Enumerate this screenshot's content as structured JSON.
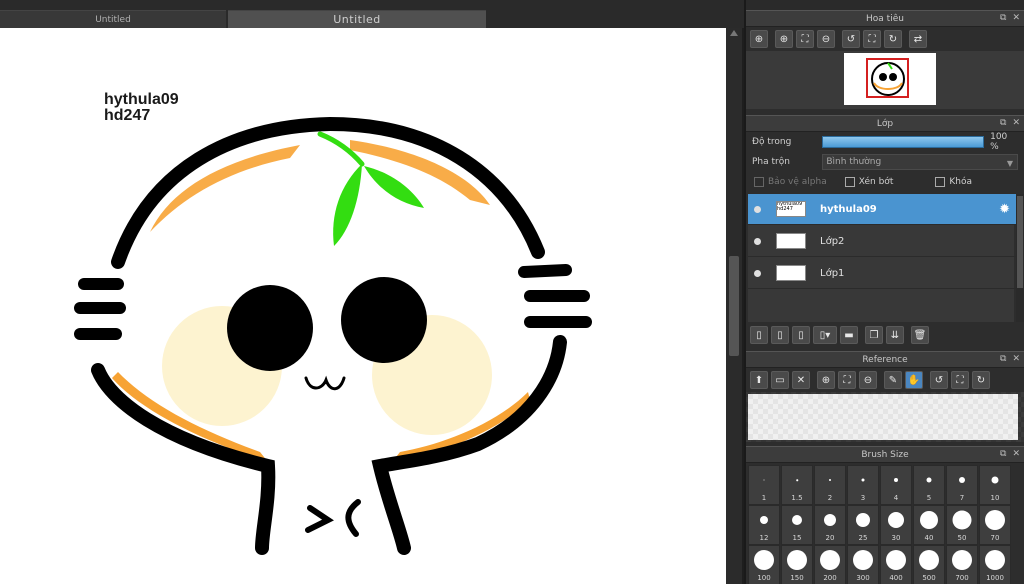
{
  "tabs": [
    {
      "label": "Untitled"
    },
    {
      "label": "Untitled"
    }
  ],
  "canvas_text": {
    "line1": "hythula09",
    "line2": "hd247"
  },
  "navigator": {
    "title": "Hoa tiêu",
    "tools": [
      "zoom-fit-icon",
      "zoom-in-icon",
      "fit-window-icon",
      "zoom-out-icon",
      "rotate-left-icon",
      "fit-page-icon",
      "rotate-right-icon",
      "flip-icon"
    ]
  },
  "layers_panel": {
    "title": "Lớp",
    "opacity_label": "Độ trong",
    "opacity_value": "100 %",
    "opacity_fraction": 1.0,
    "blend_label": "Pha trộn",
    "blend_value": "Bình thường",
    "protect_alpha": "Bảo vệ alpha",
    "clip": "Xén bớt",
    "lock": "Khóa",
    "layers": [
      {
        "name": "hythula09",
        "thumb": "hythula09 hd247",
        "selected": true
      },
      {
        "name": "Lớp2",
        "selected": false
      },
      {
        "name": "Lớp1",
        "selected": false
      }
    ]
  },
  "reference": {
    "title": "Reference"
  },
  "brush_size": {
    "title": "Brush Size",
    "sizes": [
      "1",
      "1.5",
      "2",
      "3",
      "4",
      "5",
      "7",
      "10",
      "12",
      "15",
      "20",
      "25",
      "30",
      "40",
      "50",
      "70",
      "100",
      "150",
      "200",
      "300",
      "400",
      "500",
      "700",
      "1000"
    ]
  },
  "colors": {
    "accent": "#4a94d0",
    "opacity_bar": "#5aa6dc",
    "nav_rect": "#d42020",
    "leaf": "#33dd11",
    "orange": "#f7a334",
    "cheek": "#fdf3d0"
  }
}
